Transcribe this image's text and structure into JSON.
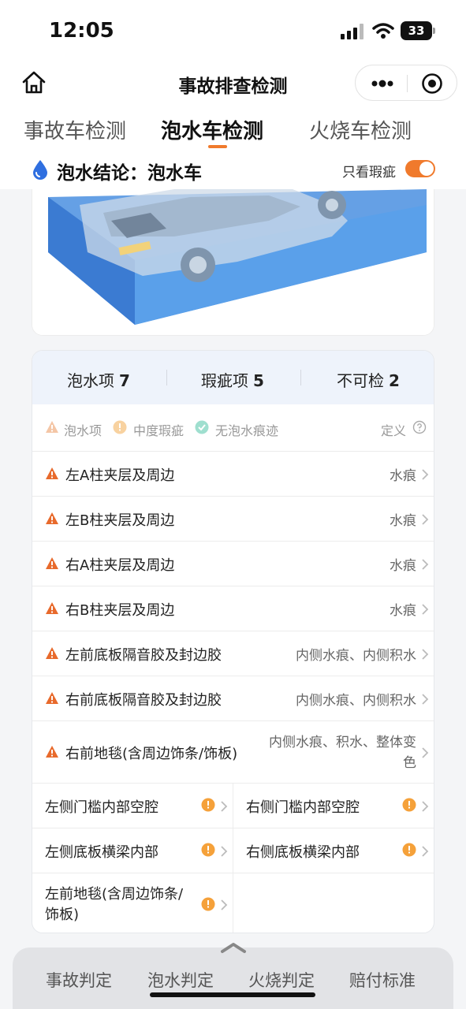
{
  "status_bar": {
    "time": "12:05",
    "battery": "33"
  },
  "nav": {
    "title": "事故排查检测"
  },
  "tabs": [
    {
      "label": "事故车检测",
      "active": false
    },
    {
      "label": "泡水车检测",
      "active": true
    },
    {
      "label": "火烧车检测",
      "active": false
    }
  ],
  "conclusion": {
    "text": "泡水结论：泡水车",
    "toggle_label": "只看瑕疵",
    "toggle_on": true
  },
  "stats": [
    {
      "label": "泡水项",
      "count": "7"
    },
    {
      "label": "瑕疵项",
      "count": "5"
    },
    {
      "label": "不可检",
      "count": "2"
    }
  ],
  "legend": {
    "water": "泡水项",
    "moderate": "中度瑕疵",
    "none": "无泡水痕迹",
    "definition": "定义"
  },
  "water_items": [
    {
      "label": "左A柱夹层及周边",
      "value": "水痕"
    },
    {
      "label": "左B柱夹层及周边",
      "value": "水痕"
    },
    {
      "label": "右A柱夹层及周边",
      "value": "水痕"
    },
    {
      "label": "右B柱夹层及周边",
      "value": "水痕"
    },
    {
      "label": "左前底板隔音胶及封边胶",
      "value": "内侧水痕、内侧积水"
    },
    {
      "label": "右前底板隔音胶及封边胶",
      "value": "内侧水痕、内侧积水"
    },
    {
      "label": "右前地毯(含周边饰条/饰板)",
      "value": "内侧水痕、积水、整体变色"
    }
  ],
  "flaw_items": [
    {
      "label": "左侧门槛内部空腔"
    },
    {
      "label": "右侧门槛内部空腔"
    },
    {
      "label": "左侧底板横梁内部"
    },
    {
      "label": "右侧底板横梁内部"
    },
    {
      "label": "左前地毯(含周边饰条/饰板)"
    }
  ],
  "bottom_tabs": [
    "事故判定",
    "泡水判定",
    "火烧判定",
    "赔付标准"
  ],
  "colors": {
    "accent": "#f07a2c",
    "warn": "#e86a2c",
    "moderate": "#f5a13a",
    "ok": "#3cc0a0",
    "water_blue": "#2f6fe0"
  }
}
